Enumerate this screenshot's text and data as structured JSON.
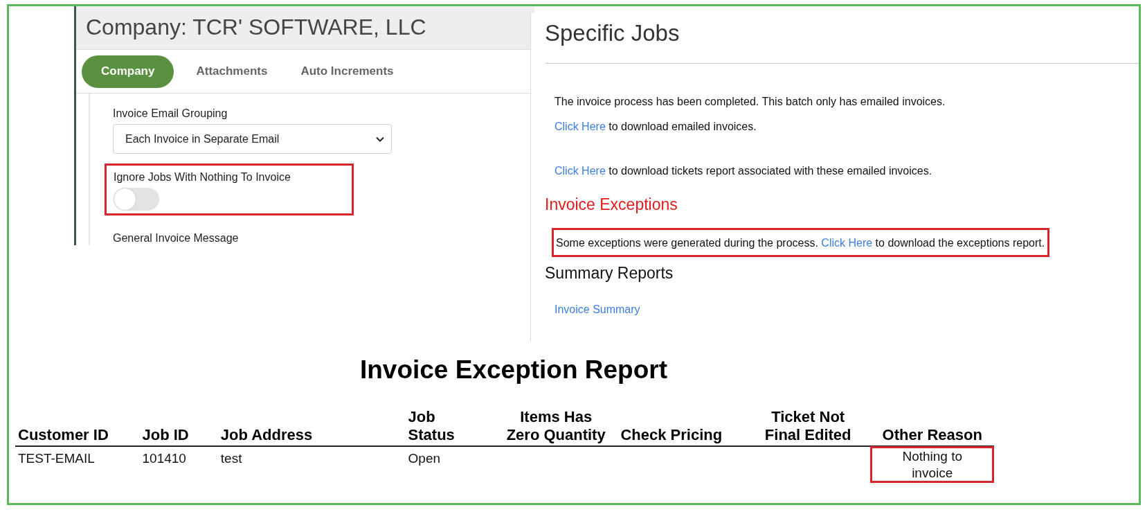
{
  "company_panel": {
    "title": "Company: TCR' SOFTWARE, LLC",
    "tabs": [
      {
        "label": "Company",
        "selected": true
      },
      {
        "label": "Attachments",
        "selected": false
      },
      {
        "label": "Auto Increments",
        "selected": false
      }
    ],
    "email_grouping": {
      "label": "Invoice Email Grouping",
      "value": "Each Invoice in Separate Email"
    },
    "ignore_jobs": {
      "label": "Ignore Jobs With Nothing To Invoice",
      "on": false,
      "highlighted": true
    },
    "general_message": {
      "label": "General Invoice Message"
    }
  },
  "jobs_panel": {
    "title": "Specific Jobs",
    "message": "The invoice process has been completed. This batch only has emailed invoices.",
    "downloads": [
      {
        "link": "Click Here",
        "text": "to download emailed invoices."
      },
      {
        "link": "Click Here",
        "text": "to download tickets report associated with these emailed invoices."
      }
    ],
    "exceptions": {
      "heading": "Invoice Exceptions",
      "text": "Some exceptions were generated during the process.",
      "link": "Click Here",
      "text_after": "to download the exceptions report.",
      "highlighted": true
    },
    "summary": {
      "heading": "Summary Reports",
      "links": [
        "Invoice Summary"
      ]
    }
  },
  "report": {
    "title": "Invoice Exception Report",
    "columns": [
      "Customer ID",
      "Job ID",
      "Job Address",
      "Job Status",
      "Items Has Zero Quantity",
      "Check Pricing",
      "Ticket Not Final Edited",
      "Other Reason"
    ],
    "rows": [
      {
        "customer_id": {
          "text": "TEST-EMAIL",
          "highlighted": false
        },
        "job_id": {
          "text": "101410",
          "highlighted": false
        },
        "job_address": {
          "text": "test",
          "highlighted": false
        },
        "job_status": {
          "text": "Open",
          "highlighted": false
        },
        "other_reason": {
          "text": "Nothing to invoice",
          "highlighted": true
        }
      }
    ]
  }
}
